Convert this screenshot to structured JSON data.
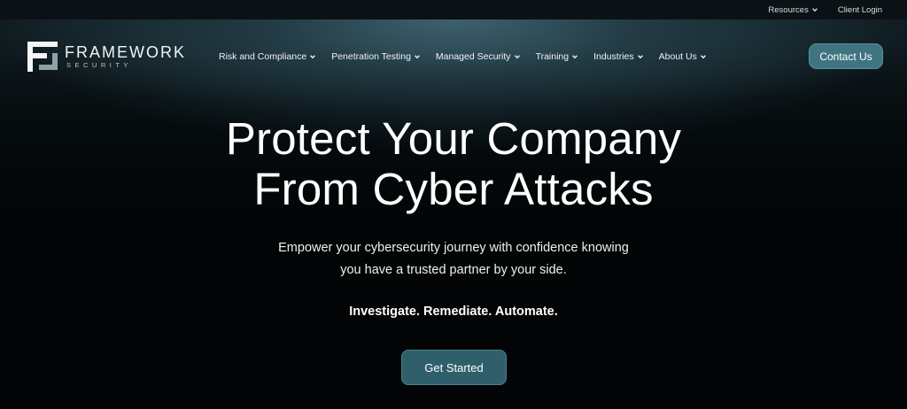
{
  "topbar": {
    "links": [
      {
        "label": "Resources",
        "has_dropdown": true
      },
      {
        "label": "Client Login",
        "has_dropdown": false
      }
    ]
  },
  "brand": {
    "name": "FRAMEWORK",
    "sub": "SECURITY"
  },
  "nav": {
    "items": [
      {
        "label": "Risk and Compliance"
      },
      {
        "label": "Penetration Testing"
      },
      {
        "label": "Managed Security"
      },
      {
        "label": "Training"
      },
      {
        "label": "Industries"
      },
      {
        "label": "About Us"
      }
    ],
    "contact_label": "Contact Us"
  },
  "hero": {
    "headline_line1": "Protect Your Company",
    "headline_line2": "From Cyber Attacks",
    "subtext_line1": "Empower your cybersecurity journey with confidence knowing",
    "subtext_line2": "you have a trusted partner by your side.",
    "tagline": "Investigate. Remediate. Automate.",
    "cta_label": "Get Started"
  },
  "colors": {
    "accent": "#3f7481",
    "cta": "#2f5f6b",
    "background": "#020405",
    "topbar": "#0b1114"
  },
  "icons": {
    "dropdown": "chevron-down-icon",
    "logo": "framework-logo-icon"
  }
}
